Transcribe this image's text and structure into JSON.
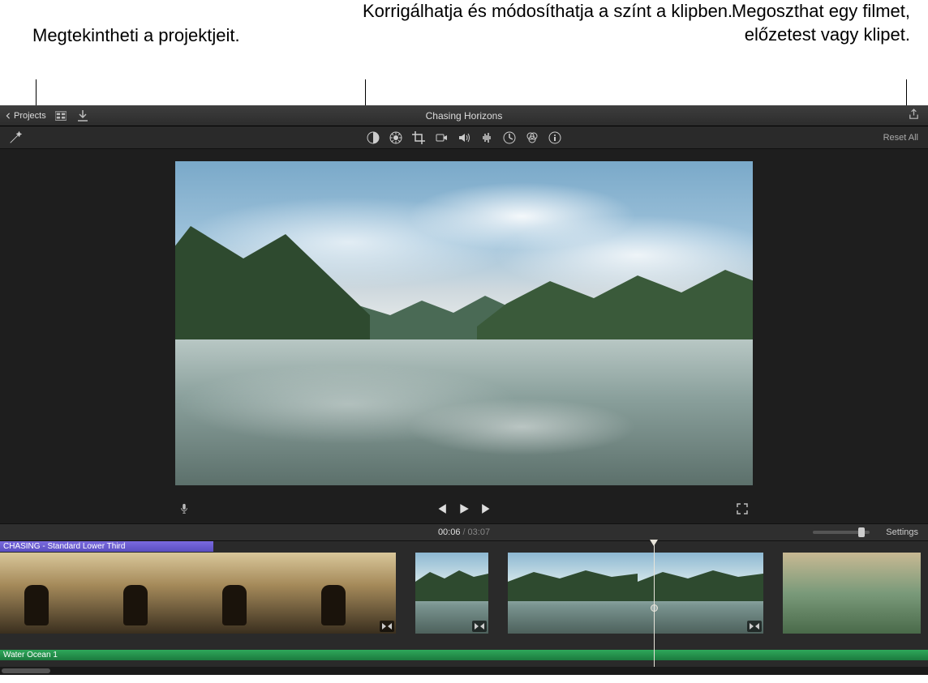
{
  "callouts": {
    "projects": "Megtekintheti a projektjeit.",
    "color": "Korrigálhatja és módosíthatja a színt a klipben.",
    "share": "Megoszthat egy filmet, előzetest vagy klipet."
  },
  "topbar": {
    "projects_label": "Projects",
    "project_title": "Chasing Horizons"
  },
  "adjustbar": {
    "reset_label": "Reset All"
  },
  "timecode": {
    "current": "00:06",
    "separator": "/",
    "duration": "03:07",
    "settings_label": "Settings"
  },
  "timeline": {
    "title_clip_label": "CHASING - Standard Lower Third",
    "audio_clip_label": "Water Ocean 1"
  }
}
